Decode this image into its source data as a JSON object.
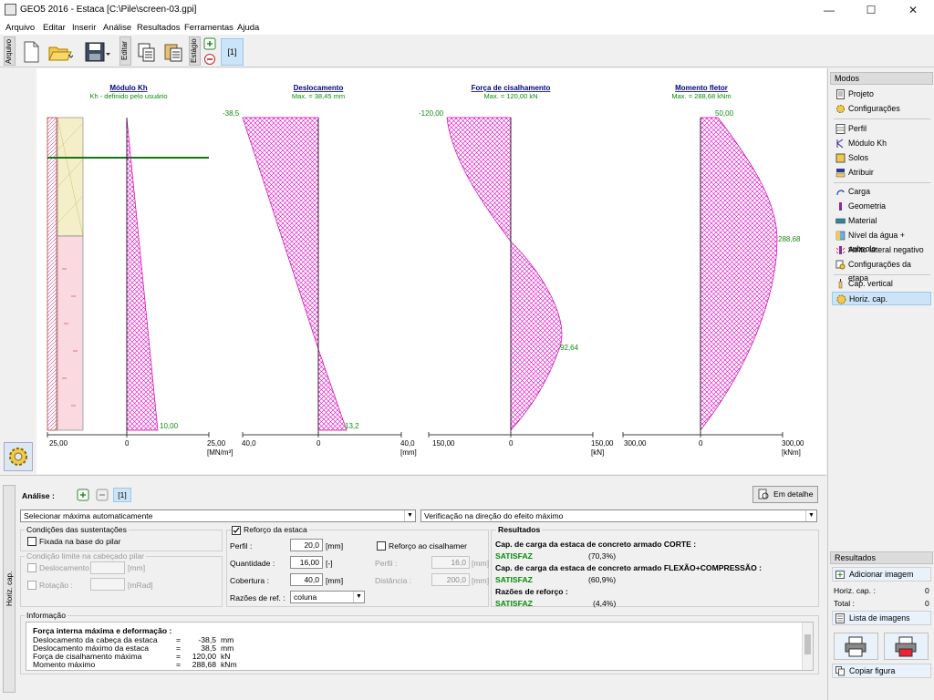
{
  "window": {
    "title": "GEO5 2016 - Estaca [C:\\Pile\\screen-03.gpi]"
  },
  "menu": [
    "Arquivo",
    "Editar",
    "Inserir",
    "Análise",
    "Resultados",
    "Ferramentas",
    "Ajuda"
  ],
  "toolbar": {
    "arquivo_label": "Arquivo",
    "editar_label": "Editar",
    "estagio_label": "Estágio",
    "stage_button": "[1]"
  },
  "modes": {
    "title": "Modos",
    "items": [
      "Projeto",
      "Configurações",
      "Perfil",
      "Módulo Kh",
      "Solos",
      "Atribuir",
      "Carga",
      "Geometria",
      "Material",
      "Nível da água + subsolo",
      "Atrito lateral negativo",
      "Configurações da etapa",
      "Cap. vertical",
      "Horiz. cap."
    ],
    "active": "Horiz. cap."
  },
  "results_panel": {
    "title": "Resultados",
    "add_image": "Adicionar imagem",
    "horiz_label": "Horiz. cap. :",
    "horiz_value": "0",
    "total_label": "Total :",
    "total_value": "0",
    "list_images": "Lista de imagens",
    "copy_figure": "Copiar figura"
  },
  "diagrams": {
    "kh": {
      "title": "Módulo Kh",
      "subtitle": "Kh - definido pelo usuário",
      "bottom_value": "10,00",
      "axis_left": "25,00",
      "axis_mid": "0",
      "axis_right": "25,00",
      "unit": "[MN/m³]"
    },
    "displacement": {
      "title": "Deslocamento",
      "subtitle": "Max. = 38,45 mm",
      "top_value": "-38,5",
      "bottom_value": "13,2",
      "axis_left": "40,0",
      "axis_mid": "0",
      "axis_right": "40,0",
      "unit": "[mm]"
    },
    "shear": {
      "title": "Força de cisalhamento",
      "subtitle": "Max. = 120,00 kN",
      "top_value": "-120,00",
      "peak_value": "92,64",
      "axis_left": "150,00",
      "axis_mid": "0",
      "axis_right": "150,00",
      "unit": "[kN]"
    },
    "moment": {
      "title": "Momento fletor",
      "subtitle": "Max. = 288,68 kNm",
      "top_value": "50,00",
      "peak_value": "288,68",
      "axis_left": "300,00",
      "axis_mid": "0",
      "axis_right": "300,00",
      "unit": "[kNm]"
    }
  },
  "analysis": {
    "label": "Análise :",
    "stage_tab": "[1]",
    "detail_button": "Em detalhe",
    "select_left": "Selecionar máxima automaticamente",
    "select_right": "Verificação na direção do efeito máximo",
    "side_tab": "Horiz. cap."
  },
  "support": {
    "title": "Condições das sustentações",
    "fixed_label": "Fixada na base do pilar",
    "limit_title": "Condição limite na cabeçado pilar",
    "disp_label": "Deslocamento :",
    "disp_unit": "[mm]",
    "rot_label": "Rotação :",
    "rot_unit": "[mRad]"
  },
  "reinforcement": {
    "title": "Reforço da estaca",
    "profile_label": "Perfil :",
    "profile_value": "20,0",
    "profile_unit": "[mm]",
    "qty_label": "Quantidade :",
    "qty_value": "16,00",
    "qty_unit": "[-]",
    "cover_label": "Cobertura :",
    "cover_value": "40,0",
    "cover_unit": "[mm]",
    "ratio_label": "Razões de ref. :",
    "ratio_value": "coluna",
    "shear_title": "Reforço ao cisalhamer",
    "shear_profile_label": "Perfil :",
    "shear_profile_value": "16,0",
    "shear_profile_unit": "[mm]",
    "shear_dist_label": "Distância :",
    "shear_dist_value": "200,0",
    "shear_dist_unit": "[mm]"
  },
  "results": {
    "title": "Resultados",
    "r1_title": "Cap. de carga da estaca de concreto armado CORTE :",
    "r1_status": "SATISFAZ",
    "r1_pct": "(70,3%)",
    "r2_title": "Cap. de carga da estaca de concreto armado FLEXÃO+COMPRESSÃO :",
    "r2_status": "SATISFAZ",
    "r2_pct": "(60,9%)",
    "r3_title": "Razões de reforço :",
    "r3_status": "SATISFAZ",
    "r3_pct": "(4,4%)"
  },
  "info": {
    "title": "Informação",
    "heading": "Força interna máxima e deformação :",
    "rows": [
      {
        "label": "Deslocamento da cabeça da estaca",
        "eq": "=",
        "value": "-38,5",
        "unit": "mm"
      },
      {
        "label": "Deslocamento máximo da estaca",
        "eq": "=",
        "value": "38,5",
        "unit": "mm"
      },
      {
        "label": "Força de cisalhamento máxima",
        "eq": "=",
        "value": "120,00",
        "unit": "kN"
      },
      {
        "label": "Momento máximo",
        "eq": "=",
        "value": "288,68",
        "unit": "kNm"
      }
    ]
  },
  "colors": {
    "hatch": "#e000c8",
    "water_line": "#0f7a0f",
    "title_blue": "#00008b",
    "subtitle_green": "#0a8a0a",
    "value_green": "#128a12"
  }
}
